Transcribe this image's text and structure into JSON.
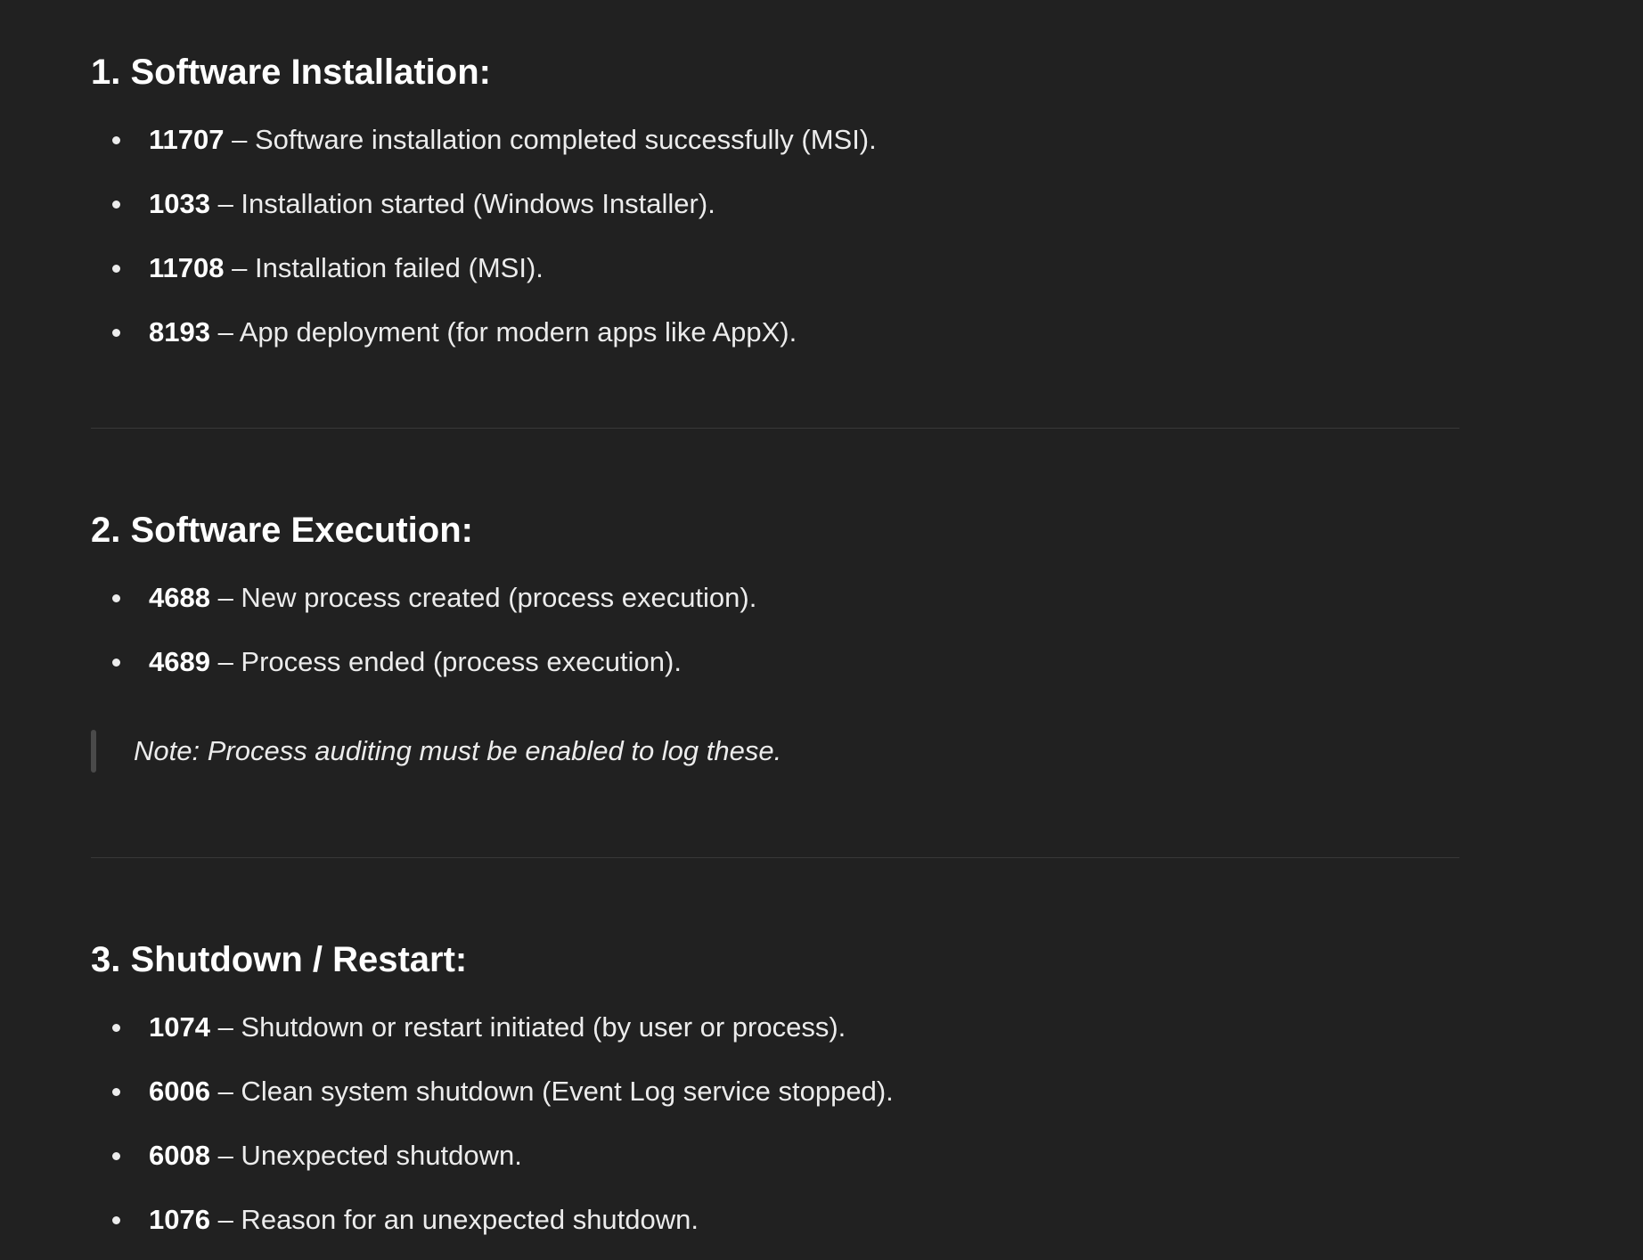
{
  "sections": [
    {
      "title": "1. Software Installation:",
      "items": [
        {
          "code": "11707",
          "text": " – Software installation completed successfully (MSI)."
        },
        {
          "code": "1033",
          "text": " – Installation started (Windows Installer)."
        },
        {
          "code": "11708",
          "text": " – Installation failed (MSI)."
        },
        {
          "code": "8193",
          "text": " – App deployment (for modern apps like AppX)."
        }
      ]
    },
    {
      "title": "2. Software Execution:",
      "items": [
        {
          "code": "4688",
          "text": " – New process created (process execution)."
        },
        {
          "code": "4689",
          "text": " – Process ended (process execution)."
        }
      ],
      "note": "Note: Process auditing must be enabled to log these."
    },
    {
      "title": "3. Shutdown / Restart:",
      "items": [
        {
          "code": "1074",
          "text": " – Shutdown or restart initiated (by user or process)."
        },
        {
          "code": "6006",
          "text": " – Clean system shutdown (Event Log service stopped)."
        },
        {
          "code": "6008",
          "text": " – Unexpected shutdown."
        },
        {
          "code": "1076",
          "text": " – Reason for an unexpected shutdown."
        }
      ]
    }
  ]
}
